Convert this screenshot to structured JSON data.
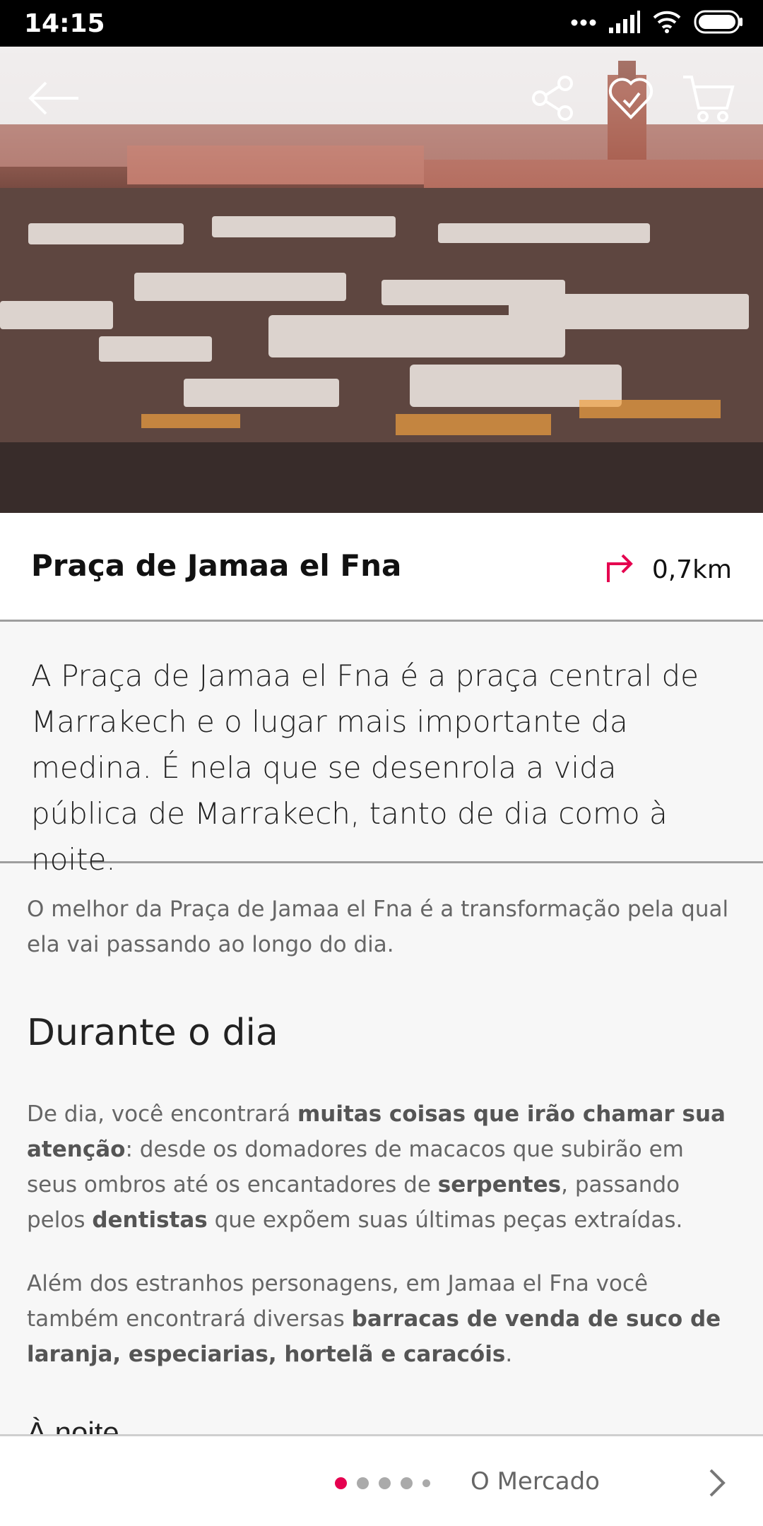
{
  "status": {
    "time": "14:15"
  },
  "place": {
    "title": "Praça de Jamaa el Fna",
    "distance": "0,7km"
  },
  "intro": "A Praça de Jamaa el Fna é a praça central de Marrakech e o lugar mais importante da medina.  É nela que se desenrola a vida pública de Marrakech, tanto de dia como à noite.",
  "content": {
    "lead": "O melhor da Praça de Jamaa el Fna é a transformação pela qual ela vai passando ao longo do dia.",
    "heading": "Durante o dia",
    "p1": {
      "t1": "De dia, você encontrará ",
      "b1": "muitas coisas que irão chamar sua atenção",
      "t2": ": desde os domadores de macacos que subirão em seus ombros até os encantadores de ",
      "b2": "serpentes",
      "t3": ", passando pelos ",
      "b3": "dentistas",
      "t4": " que expõem suas últimas peças extraídas."
    },
    "p2": {
      "t1": "Além dos estranhos personagens, em Jamaa el Fna você também encontrará diversas ",
      "b1": "barracas de venda de suco de laranja, especiarias, hortelã e caracóis",
      "t2": "."
    },
    "cut": "À noite"
  },
  "pager": {
    "next_label": "O Mercado",
    "pages": 5,
    "current": 1
  },
  "icons": [
    "back-arrow-icon",
    "share-icon",
    "favorite-icon",
    "cart-icon",
    "directions-icon",
    "chevron-right-icon",
    "signal-icon",
    "wifi-icon",
    "battery-icon"
  ],
  "colors": {
    "accent": "#e5004f"
  }
}
